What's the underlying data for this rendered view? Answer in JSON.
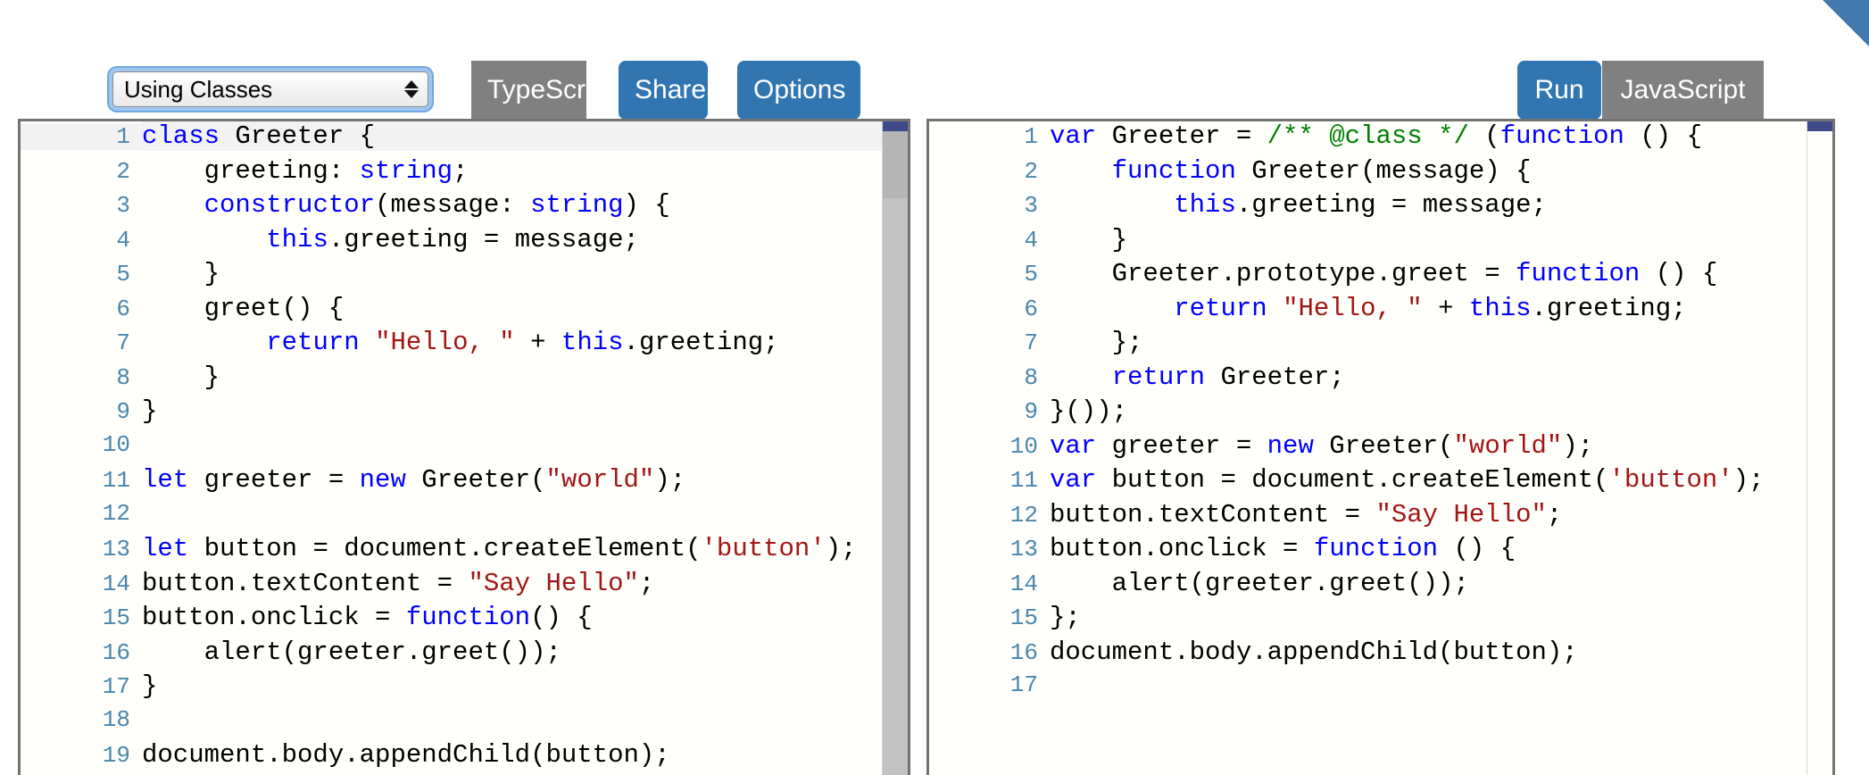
{
  "window": {
    "corner_ribbon_color": "#427ab0"
  },
  "toolbar": {
    "sample_select": {
      "value": "Using Classes",
      "name": "sample-selector"
    },
    "buttons": [
      {
        "id": "typescript",
        "label": "TypeScript",
        "style": "grey"
      },
      {
        "id": "share",
        "label": "Share",
        "style": "blue"
      },
      {
        "id": "options",
        "label": "Options",
        "style": "blue"
      },
      {
        "id": "run",
        "label": "Run",
        "style": "blue"
      },
      {
        "id": "javascript",
        "label": "JavaScript",
        "style": "grey"
      }
    ],
    "labels": {
      "typescript": "TypeScript",
      "share": "Share",
      "options": "Options",
      "run": "Run",
      "javascript": "JavaScript"
    },
    "colors": {
      "blue": "#3276b1",
      "grey": "#808080",
      "focus_ring": "#6fa8e0"
    }
  },
  "editors": {
    "left": {
      "language": "TypeScript",
      "active_line": 1,
      "line_count": 19,
      "lines": [
        {
          "n": "1",
          "tokens": [
            {
              "t": "class",
              "c": "kw"
            },
            {
              "t": " Greeter {",
              "c": "plain"
            }
          ]
        },
        {
          "n": "2",
          "tokens": [
            {
              "t": "    greeting: ",
              "c": "plain"
            },
            {
              "t": "string",
              "c": "kw"
            },
            {
              "t": ";",
              "c": "plain"
            }
          ]
        },
        {
          "n": "3",
          "tokens": [
            {
              "t": "    ",
              "c": "plain"
            },
            {
              "t": "constructor",
              "c": "kw"
            },
            {
              "t": "(message: ",
              "c": "plain"
            },
            {
              "t": "string",
              "c": "kw"
            },
            {
              "t": ") {",
              "c": "plain"
            }
          ]
        },
        {
          "n": "4",
          "tokens": [
            {
              "t": "        ",
              "c": "plain"
            },
            {
              "t": "this",
              "c": "kw"
            },
            {
              "t": ".greeting = message;",
              "c": "plain"
            }
          ]
        },
        {
          "n": "5",
          "tokens": [
            {
              "t": "    }",
              "c": "plain"
            }
          ]
        },
        {
          "n": "6",
          "tokens": [
            {
              "t": "    greet() {",
              "c": "plain"
            }
          ]
        },
        {
          "n": "7",
          "tokens": [
            {
              "t": "        ",
              "c": "plain"
            },
            {
              "t": "return",
              "c": "kw"
            },
            {
              "t": " ",
              "c": "plain"
            },
            {
              "t": "\"Hello, \"",
              "c": "str"
            },
            {
              "t": " + ",
              "c": "plain"
            },
            {
              "t": "this",
              "c": "kw"
            },
            {
              "t": ".greeting;",
              "c": "plain"
            }
          ]
        },
        {
          "n": "8",
          "tokens": [
            {
              "t": "    }",
              "c": "plain"
            }
          ]
        },
        {
          "n": "9",
          "tokens": [
            {
              "t": "}",
              "c": "plain"
            }
          ]
        },
        {
          "n": "10",
          "tokens": [
            {
              "t": "",
              "c": "plain"
            }
          ]
        },
        {
          "n": "11",
          "tokens": [
            {
              "t": "let",
              "c": "kw"
            },
            {
              "t": " greeter = ",
              "c": "plain"
            },
            {
              "t": "new",
              "c": "kw"
            },
            {
              "t": " Greeter(",
              "c": "plain"
            },
            {
              "t": "\"world\"",
              "c": "str"
            },
            {
              "t": ");",
              "c": "plain"
            }
          ]
        },
        {
          "n": "12",
          "tokens": [
            {
              "t": "",
              "c": "plain"
            }
          ]
        },
        {
          "n": "13",
          "tokens": [
            {
              "t": "let",
              "c": "kw"
            },
            {
              "t": " button = document.createElement(",
              "c": "plain"
            },
            {
              "t": "'button'",
              "c": "str"
            },
            {
              "t": ");",
              "c": "plain"
            }
          ]
        },
        {
          "n": "14",
          "tokens": [
            {
              "t": "button.textContent = ",
              "c": "plain"
            },
            {
              "t": "\"Say Hello\"",
              "c": "str"
            },
            {
              "t": ";",
              "c": "plain"
            }
          ]
        },
        {
          "n": "15",
          "tokens": [
            {
              "t": "button.onclick = ",
              "c": "plain"
            },
            {
              "t": "function",
              "c": "kw"
            },
            {
              "t": "() {",
              "c": "plain"
            }
          ]
        },
        {
          "n": "16",
          "tokens": [
            {
              "t": "    alert(greeter.greet());",
              "c": "plain"
            }
          ]
        },
        {
          "n": "17",
          "tokens": [
            {
              "t": "}",
              "c": "plain"
            }
          ]
        },
        {
          "n": "18",
          "tokens": [
            {
              "t": "",
              "c": "plain"
            }
          ]
        },
        {
          "n": "19",
          "tokens": [
            {
              "t": "document.body.appendChild(button);",
              "c": "plain"
            }
          ]
        }
      ],
      "source_text": "class Greeter {\n    greeting: string;\n    constructor(message: string) {\n        this.greeting = message;\n    }\n    greet() {\n        return \"Hello, \" + this.greeting;\n    }\n}\n\nlet greeter = new Greeter(\"world\");\n\nlet button = document.createElement('button');\nbutton.textContent = \"Say Hello\";\nbutton.onclick = function() {\n    alert(greeter.greet());\n}\n\ndocument.body.appendChild(button);"
    },
    "right": {
      "language": "JavaScript",
      "line_count": 17,
      "lines": [
        {
          "n": "1",
          "tokens": [
            {
              "t": "var",
              "c": "kw"
            },
            {
              "t": " Greeter = ",
              "c": "plain"
            },
            {
              "t": "/** @class */",
              "c": "cmt"
            },
            {
              "t": " (",
              "c": "plain"
            },
            {
              "t": "function",
              "c": "kw"
            },
            {
              "t": " () {",
              "c": "plain"
            }
          ]
        },
        {
          "n": "2",
          "tokens": [
            {
              "t": "    ",
              "c": "plain"
            },
            {
              "t": "function",
              "c": "kw"
            },
            {
              "t": " Greeter(message) {",
              "c": "plain"
            }
          ]
        },
        {
          "n": "3",
          "tokens": [
            {
              "t": "        ",
              "c": "plain"
            },
            {
              "t": "this",
              "c": "kw"
            },
            {
              "t": ".greeting = message;",
              "c": "plain"
            }
          ]
        },
        {
          "n": "4",
          "tokens": [
            {
              "t": "    }",
              "c": "plain"
            }
          ]
        },
        {
          "n": "5",
          "tokens": [
            {
              "t": "    Greeter.prototype.greet = ",
              "c": "plain"
            },
            {
              "t": "function",
              "c": "kw"
            },
            {
              "t": " () {",
              "c": "plain"
            }
          ]
        },
        {
          "n": "6",
          "tokens": [
            {
              "t": "        ",
              "c": "plain"
            },
            {
              "t": "return",
              "c": "kw"
            },
            {
              "t": " ",
              "c": "plain"
            },
            {
              "t": "\"Hello, \"",
              "c": "str"
            },
            {
              "t": " + ",
              "c": "plain"
            },
            {
              "t": "this",
              "c": "kw"
            },
            {
              "t": ".greeting;",
              "c": "plain"
            }
          ]
        },
        {
          "n": "7",
          "tokens": [
            {
              "t": "    };",
              "c": "plain"
            }
          ]
        },
        {
          "n": "8",
          "tokens": [
            {
              "t": "    ",
              "c": "plain"
            },
            {
              "t": "return",
              "c": "kw"
            },
            {
              "t": " Greeter;",
              "c": "plain"
            }
          ]
        },
        {
          "n": "9",
          "tokens": [
            {
              "t": "}());",
              "c": "plain"
            }
          ]
        },
        {
          "n": "10",
          "tokens": [
            {
              "t": "var",
              "c": "kw"
            },
            {
              "t": " greeter = ",
              "c": "plain"
            },
            {
              "t": "new",
              "c": "kw"
            },
            {
              "t": " Greeter(",
              "c": "plain"
            },
            {
              "t": "\"world\"",
              "c": "str"
            },
            {
              "t": ");",
              "c": "plain"
            }
          ]
        },
        {
          "n": "11",
          "tokens": [
            {
              "t": "var",
              "c": "kw"
            },
            {
              "t": " button = document.createElement(",
              "c": "plain"
            },
            {
              "t": "'button'",
              "c": "str"
            },
            {
              "t": ");",
              "c": "plain"
            }
          ]
        },
        {
          "n": "12",
          "tokens": [
            {
              "t": "button.textContent = ",
              "c": "plain"
            },
            {
              "t": "\"Say Hello\"",
              "c": "str"
            },
            {
              "t": ";",
              "c": "plain"
            }
          ]
        },
        {
          "n": "13",
          "tokens": [
            {
              "t": "button.onclick = ",
              "c": "plain"
            },
            {
              "t": "function",
              "c": "kw"
            },
            {
              "t": " () {",
              "c": "plain"
            }
          ]
        },
        {
          "n": "14",
          "tokens": [
            {
              "t": "    alert(greeter.greet());",
              "c": "plain"
            }
          ]
        },
        {
          "n": "15",
          "tokens": [
            {
              "t": "};",
              "c": "plain"
            }
          ]
        },
        {
          "n": "16",
          "tokens": [
            {
              "t": "document.body.appendChild(button);",
              "c": "plain"
            }
          ]
        },
        {
          "n": "17",
          "tokens": [
            {
              "t": "",
              "c": "plain"
            }
          ]
        }
      ],
      "source_text": "var Greeter = /** @class */ (function () {\n    function Greeter(message) {\n        this.greeting = message;\n    }\n    Greeter.prototype.greet = function () {\n        return \"Hello, \" + this.greeting;\n    };\n    return Greeter;\n}());\nvar greeter = new Greeter(\"world\");\nvar button = document.createElement('button');\nbutton.textContent = \"Say Hello\";\nbutton.onclick = function () {\n    alert(greeter.greet());\n};\ndocument.body.appendChild(button);\n"
    }
  },
  "syntax_colors": {
    "keyword": "#0000ff",
    "string": "#a31515",
    "comment": "#008000",
    "plain": "#000000",
    "line_number": "#4a87ad"
  }
}
